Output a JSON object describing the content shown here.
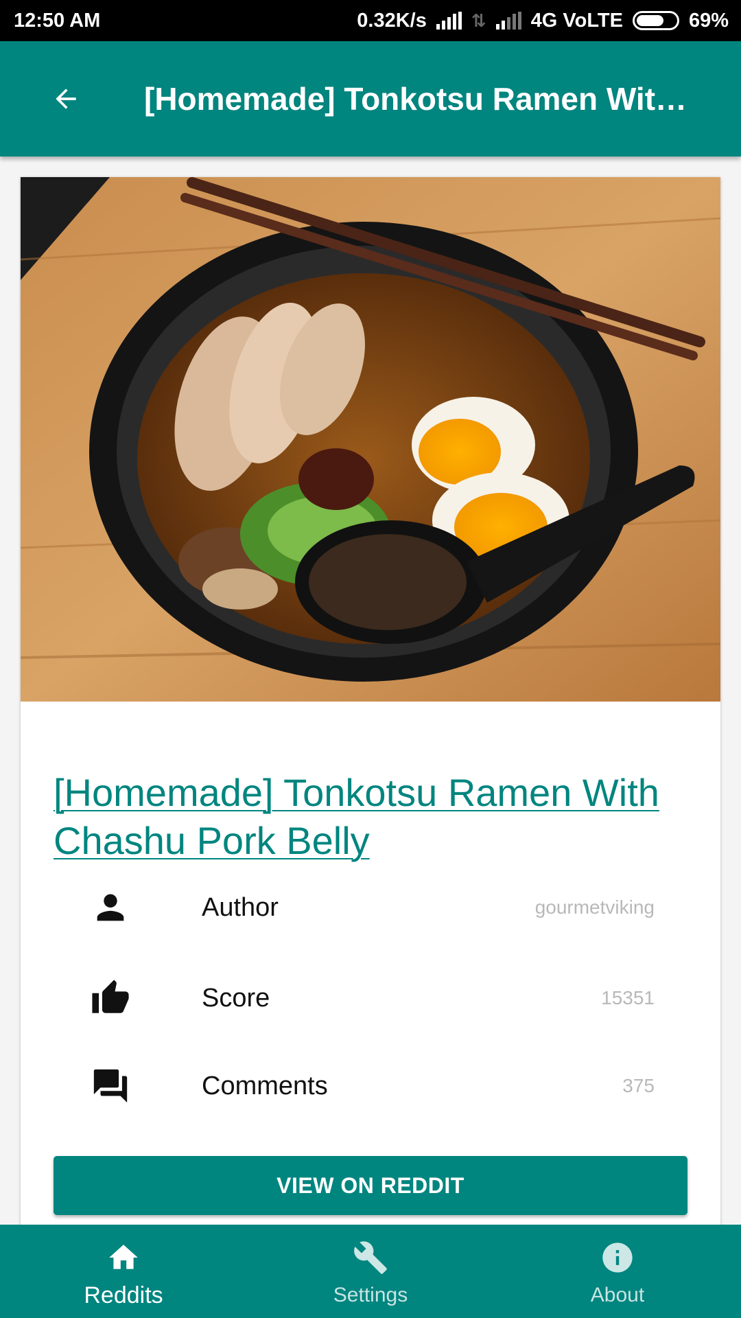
{
  "status_bar": {
    "time": "12:50 AM",
    "speed": "0.32K/s",
    "network": "4G VoLTE",
    "battery": "69%",
    "battery_level": 0.69
  },
  "app_bar": {
    "back_icon": "arrow-back-icon",
    "title": "[Homemade] Tonkotsu Ramen With ..."
  },
  "post": {
    "image_icon": "ramen-photo",
    "title": "[Homemade] Tonkotsu Ramen With Chashu Pork Belly",
    "details": [
      {
        "icon": "person-icon",
        "label": "Author",
        "value": "gourmetviking"
      },
      {
        "icon": "thumbs-up-icon",
        "label": "Score",
        "value": "15351"
      },
      {
        "icon": "comments-icon",
        "label": "Comments",
        "value": "375"
      }
    ],
    "view_button": "VIEW ON REDDIT"
  },
  "bottom_nav": {
    "items": [
      {
        "icon": "home-icon",
        "label": "Reddits",
        "active": true
      },
      {
        "icon": "tools-icon",
        "label": "Settings",
        "active": false
      },
      {
        "icon": "info-icon",
        "label": "About",
        "active": false
      }
    ]
  },
  "colors": {
    "primary": "#00857f",
    "status_bar": "#000000",
    "muted_value": "#b8b8b8"
  }
}
